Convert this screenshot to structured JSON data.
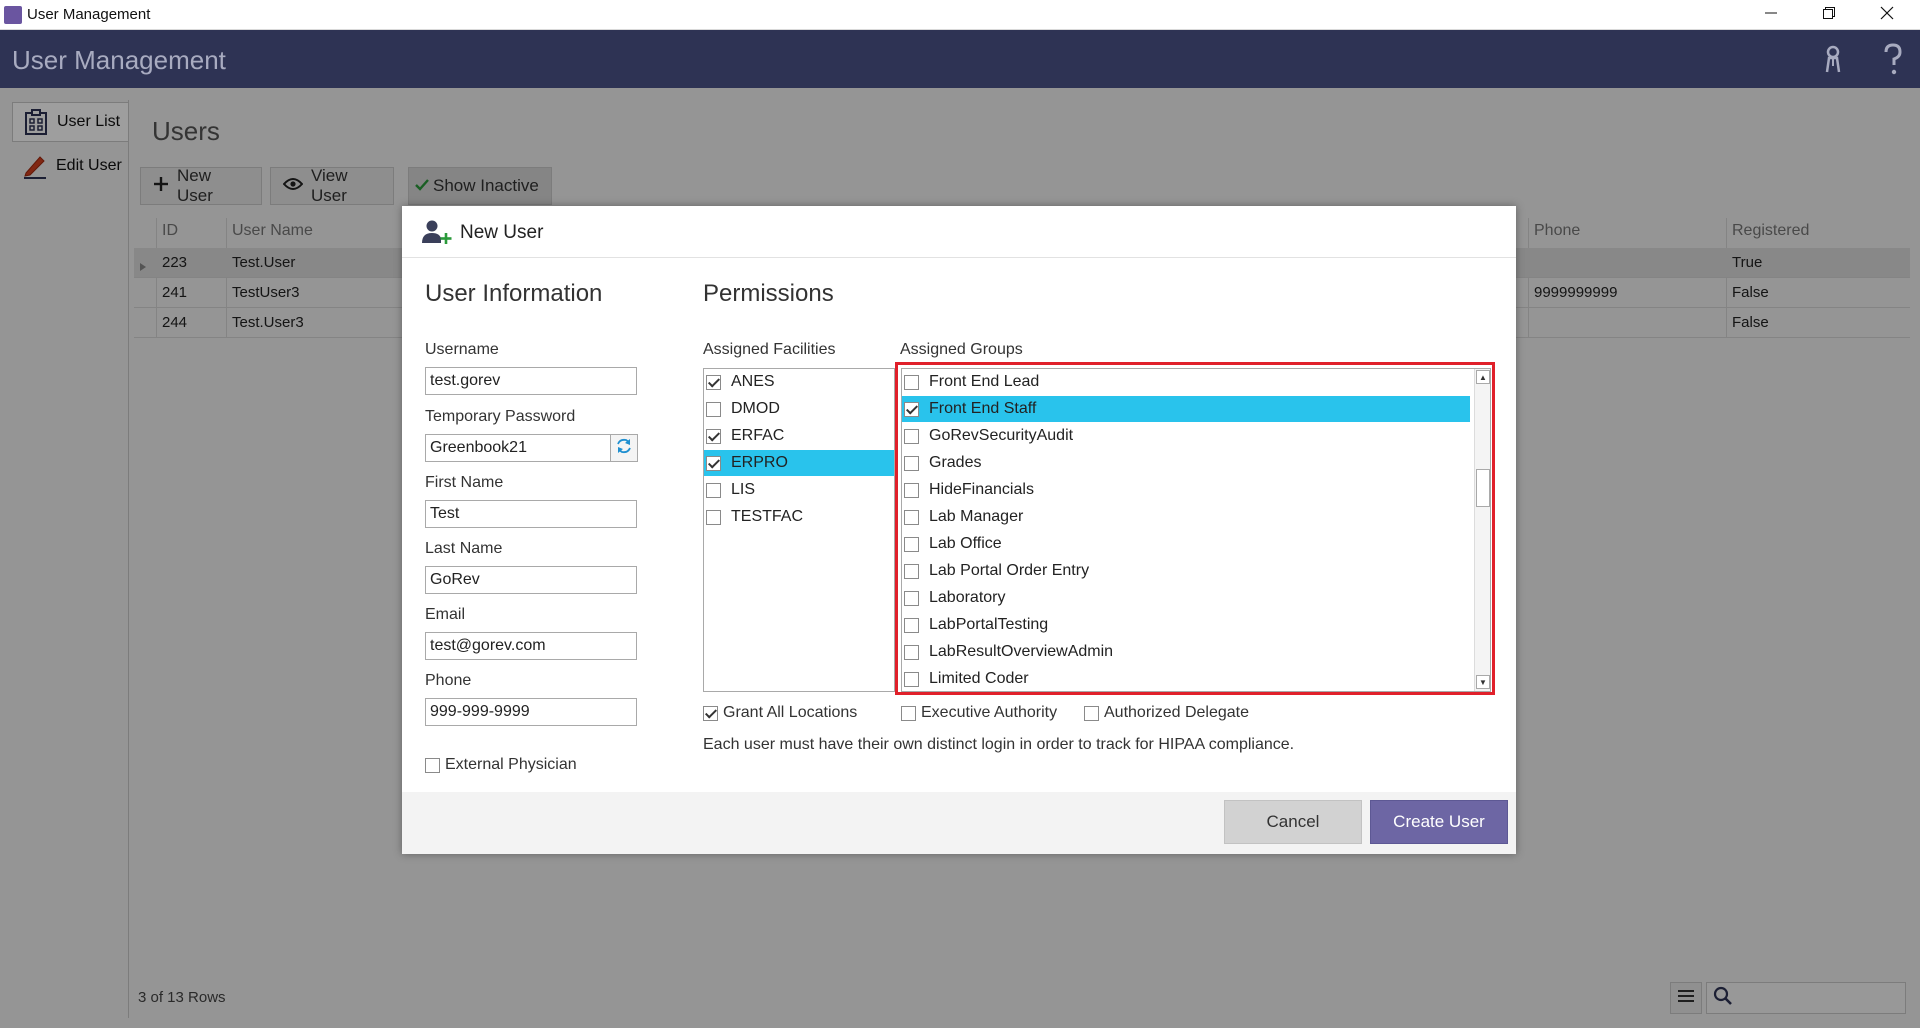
{
  "window": {
    "title": "User Management"
  },
  "header": {
    "title": "User Management"
  },
  "sidebar": {
    "tabs": [
      {
        "label": "User List"
      },
      {
        "label": "Edit User"
      }
    ]
  },
  "main": {
    "title": "Users",
    "toolbar": {
      "new_user": "New User",
      "view_user": "View User",
      "show_inactive": "Show Inactive"
    },
    "grid": {
      "columns": {
        "id": "ID",
        "username": "User Name",
        "phone": "Phone",
        "registered": "Registered"
      },
      "rows": [
        {
          "id": "223",
          "username": "Test.User",
          "phone": "",
          "registered": "True"
        },
        {
          "id": "241",
          "username": "TestUser3",
          "phone": "9999999999",
          "registered": "False"
        },
        {
          "id": "244",
          "username": "Test.User3",
          "phone": "",
          "registered": "False"
        }
      ]
    },
    "footer": {
      "row_count": "3 of 13 Rows"
    }
  },
  "dialog": {
    "title": "New User",
    "user_info": {
      "heading": "User Information",
      "username_label": "Username",
      "username_value": "test.gorev",
      "password_label": "Temporary Password",
      "password_value": "Greenbook21",
      "first_name_label": "First Name",
      "first_name_value": "Test",
      "last_name_label": "Last Name",
      "last_name_value": "GoRev",
      "email_label": "Email",
      "email_value": "test@gorev.com",
      "phone_label": "Phone",
      "phone_value": "999-999-9999",
      "external_physician_label": "External Physician"
    },
    "permissions": {
      "heading": "Permissions",
      "facilities_label": "Assigned Facilities",
      "facilities": [
        {
          "name": "ANES",
          "checked": true,
          "selected": false
        },
        {
          "name": "DMOD",
          "checked": false,
          "selected": false
        },
        {
          "name": "ERFAC",
          "checked": true,
          "selected": false
        },
        {
          "name": "ERPRO",
          "checked": true,
          "selected": true
        },
        {
          "name": "LIS",
          "checked": false,
          "selected": false
        },
        {
          "name": "TESTFAC",
          "checked": false,
          "selected": false
        }
      ],
      "groups_label": "Assigned Groups",
      "groups": [
        {
          "name": "Front End Lead",
          "checked": false,
          "selected": false
        },
        {
          "name": "Front End Staff",
          "checked": true,
          "selected": true
        },
        {
          "name": "GoRevSecurityAudit",
          "checked": false,
          "selected": false
        },
        {
          "name": "Grades",
          "checked": false,
          "selected": false
        },
        {
          "name": "HideFinancials",
          "checked": false,
          "selected": false
        },
        {
          "name": "Lab Manager",
          "checked": false,
          "selected": false
        },
        {
          "name": "Lab Office",
          "checked": false,
          "selected": false
        },
        {
          "name": "Lab Portal Order Entry",
          "checked": false,
          "selected": false
        },
        {
          "name": "Laboratory",
          "checked": false,
          "selected": false
        },
        {
          "name": "LabPortalTesting",
          "checked": false,
          "selected": false
        },
        {
          "name": "LabResultOverviewAdmin",
          "checked": false,
          "selected": false
        },
        {
          "name": "Limited Coder",
          "checked": false,
          "selected": false
        }
      ],
      "grant_all_locations": "Grant All Locations",
      "executive_authority": "Executive Authority",
      "authorized_delegate": "Authorized Delegate",
      "hipaa_note": "Each user must have their own distinct login in order to track for HIPAA compliance."
    },
    "buttons": {
      "cancel": "Cancel",
      "create": "Create User"
    }
  },
  "colors": {
    "header_bg": "#2e3354",
    "selection": "#29c3ec",
    "create_button": "#6d66a4",
    "highlight_border": "#e0202a"
  },
  "icons": [
    "app-icon",
    "minimize-icon",
    "restore-icon",
    "close-icon",
    "user-keys-icon",
    "help-icon",
    "clipboard-icon",
    "pencil-icon",
    "plus-icon",
    "eye-icon",
    "checkmark-icon",
    "add-user-icon",
    "refresh-icon",
    "menu-icon",
    "search-icon"
  ]
}
